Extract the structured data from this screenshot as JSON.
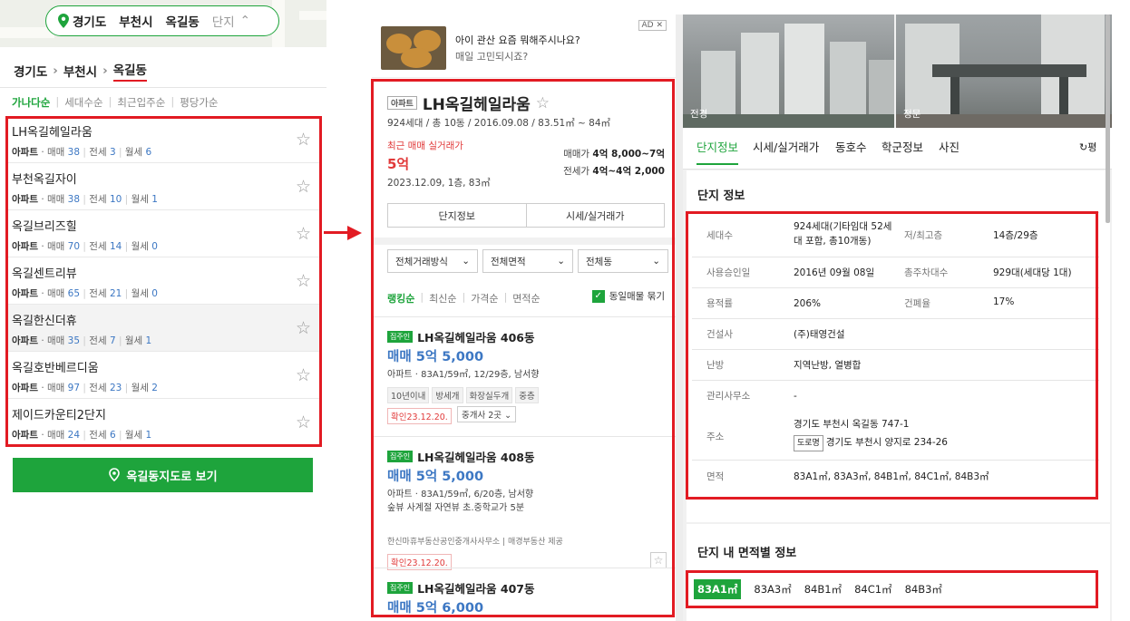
{
  "left": {
    "region_pill": {
      "province": "경기도",
      "city": "부천시",
      "dong": "옥길동",
      "complex_label": "단지"
    },
    "breadcrumb": {
      "province": "경기도",
      "city": "부천시",
      "dong": "옥길동"
    },
    "sort_tabs": [
      "가나다순",
      "세대수순",
      "최근입주순",
      "평당가순"
    ],
    "apartments": [
      {
        "name": "LH옥길헤일라움",
        "type": "아파트",
        "sale_label": "매매",
        "sale": "38",
        "jeonse_label": "전세",
        "jeonse": "3",
        "monthly_label": "월세",
        "monthly": "6"
      },
      {
        "name": "부천옥길자이",
        "type": "아파트",
        "sale_label": "매매",
        "sale": "38",
        "jeonse_label": "전세",
        "jeonse": "10",
        "monthly_label": "월세",
        "monthly": "1"
      },
      {
        "name": "옥길브리즈힐",
        "type": "아파트",
        "sale_label": "매매",
        "sale": "70",
        "jeonse_label": "전세",
        "jeonse": "14",
        "monthly_label": "월세",
        "monthly": "0"
      },
      {
        "name": "옥길센트리뷰",
        "type": "아파트",
        "sale_label": "매매",
        "sale": "65",
        "jeonse_label": "전세",
        "jeonse": "21",
        "monthly_label": "월세",
        "monthly": "0"
      },
      {
        "name": "옥길한신더휴",
        "type": "아파트",
        "sale_label": "매매",
        "sale": "35",
        "jeonse_label": "전세",
        "jeonse": "7",
        "monthly_label": "월세",
        "monthly": "1"
      },
      {
        "name": "옥길호반베르디움",
        "type": "아파트",
        "sale_label": "매매",
        "sale": "97",
        "jeonse_label": "전세",
        "jeonse": "23",
        "monthly_label": "월세",
        "monthly": "2"
      },
      {
        "name": "제이드카운티2단지",
        "type": "아파트",
        "sale_label": "매매",
        "sale": "24",
        "jeonse_label": "전세",
        "jeonse": "6",
        "monthly_label": "월세",
        "monthly": "1"
      }
    ],
    "map_button": "옥길동지도로 보기"
  },
  "middle": {
    "ad": {
      "badge": "AD ✕",
      "line1": "아이 관산 요즘 뭐해주시나요?",
      "line2": "매일 고민되시죠?"
    },
    "complex": {
      "tag": "아파트",
      "name": "LH옥길헤일라움",
      "summary": "924세대 / 총 10동 / 2016.09.08 / 83.51㎡ ~ 84㎡",
      "recent_label": "최근 매매 실거래가",
      "recent_value": "5억",
      "recent_date": "2023.12.09, 1층, 83㎡",
      "sale_label": "매매가",
      "sale_range": "4억 8,000~7억",
      "jeonse_label": "전세가",
      "jeonse_range": "4억~4억 2,000",
      "btn_info": "단지정보",
      "btn_price": "시세/실거래가"
    },
    "filters": [
      "전체거래방식",
      "전체면적",
      "전체동"
    ],
    "list_sort": [
      "랭킹순",
      "최신순",
      "가격순",
      "면적순"
    ],
    "same_listing": "동일매물 묶기",
    "listings": [
      {
        "badge": "집주인",
        "title": "LH옥길헤일라움 406동",
        "price": "매매 5억 5,000",
        "desc": "아파트 · 83A1/59㎡, 12/29층, 남서향",
        "chips": [
          "10년이내",
          "방세개",
          "화장실두개",
          "중층"
        ],
        "confirm": "확인23.12.20.",
        "agent": "중개사 2곳"
      },
      {
        "badge": "집주인",
        "title": "LH옥길헤일라움 408동",
        "price": "매매 5억 5,000",
        "desc": "아파트 · 83A1/59㎡, 6/20층, 남서향",
        "desc2": "숲뷰 사계절 자연뷰 초.중학교가 5분",
        "broker": "한신마휴부동산공인중개사사무소 | 매경부동산 제공",
        "confirm": "확인23.12.20."
      },
      {
        "badge": "집주인",
        "title": "LH옥길헤일라움 407동",
        "price": "매매 5억 6,000"
      }
    ]
  },
  "right": {
    "photos": [
      {
        "label": "전경"
      },
      {
        "label": "정문"
      }
    ],
    "tabs": [
      "단지정보",
      "시세/실거래가",
      "동호수",
      "학군정보",
      "사진"
    ],
    "tab_refresh": "↻평",
    "section_title": "단지 정보",
    "info": {
      "households_label": "세대수",
      "households": "924세대(기타임대 52세대 포함, 총10개동)",
      "floors_label": "저/최고층",
      "floors": "14층/29층",
      "approval_label": "사용승인일",
      "approval": "2016년 09월 08일",
      "parking_label": "총주차대수",
      "parking": "929대(세대당 1대)",
      "far_label": "용적률",
      "far": "206%",
      "bcr_label": "건폐율",
      "bcr": "17%",
      "builder_label": "건설사",
      "builder": "(주)태영건설",
      "heating_label": "난방",
      "heating": "지역난방, 열병합",
      "office_label": "관리사무소",
      "office": "-",
      "address_label": "주소",
      "address": "경기도 부천시 옥길동 747-1",
      "road_tag": "도로명",
      "road_address": "경기도 부천시 양지로 234-26",
      "area_label": "면적",
      "area": "83A1㎡, 83A3㎡, 84B1㎡, 84C1㎡, 84B3㎡"
    },
    "area_section_title": "단지 내 면적별 정보",
    "area_chips": [
      "83A1㎡",
      "83A3㎡",
      "84B1㎡",
      "84C1㎡",
      "84B3㎡"
    ]
  },
  "colors": {
    "brand_green": "#1ea43c",
    "highlight_red": "#e21b23",
    "price_blue": "#3c77c3"
  }
}
